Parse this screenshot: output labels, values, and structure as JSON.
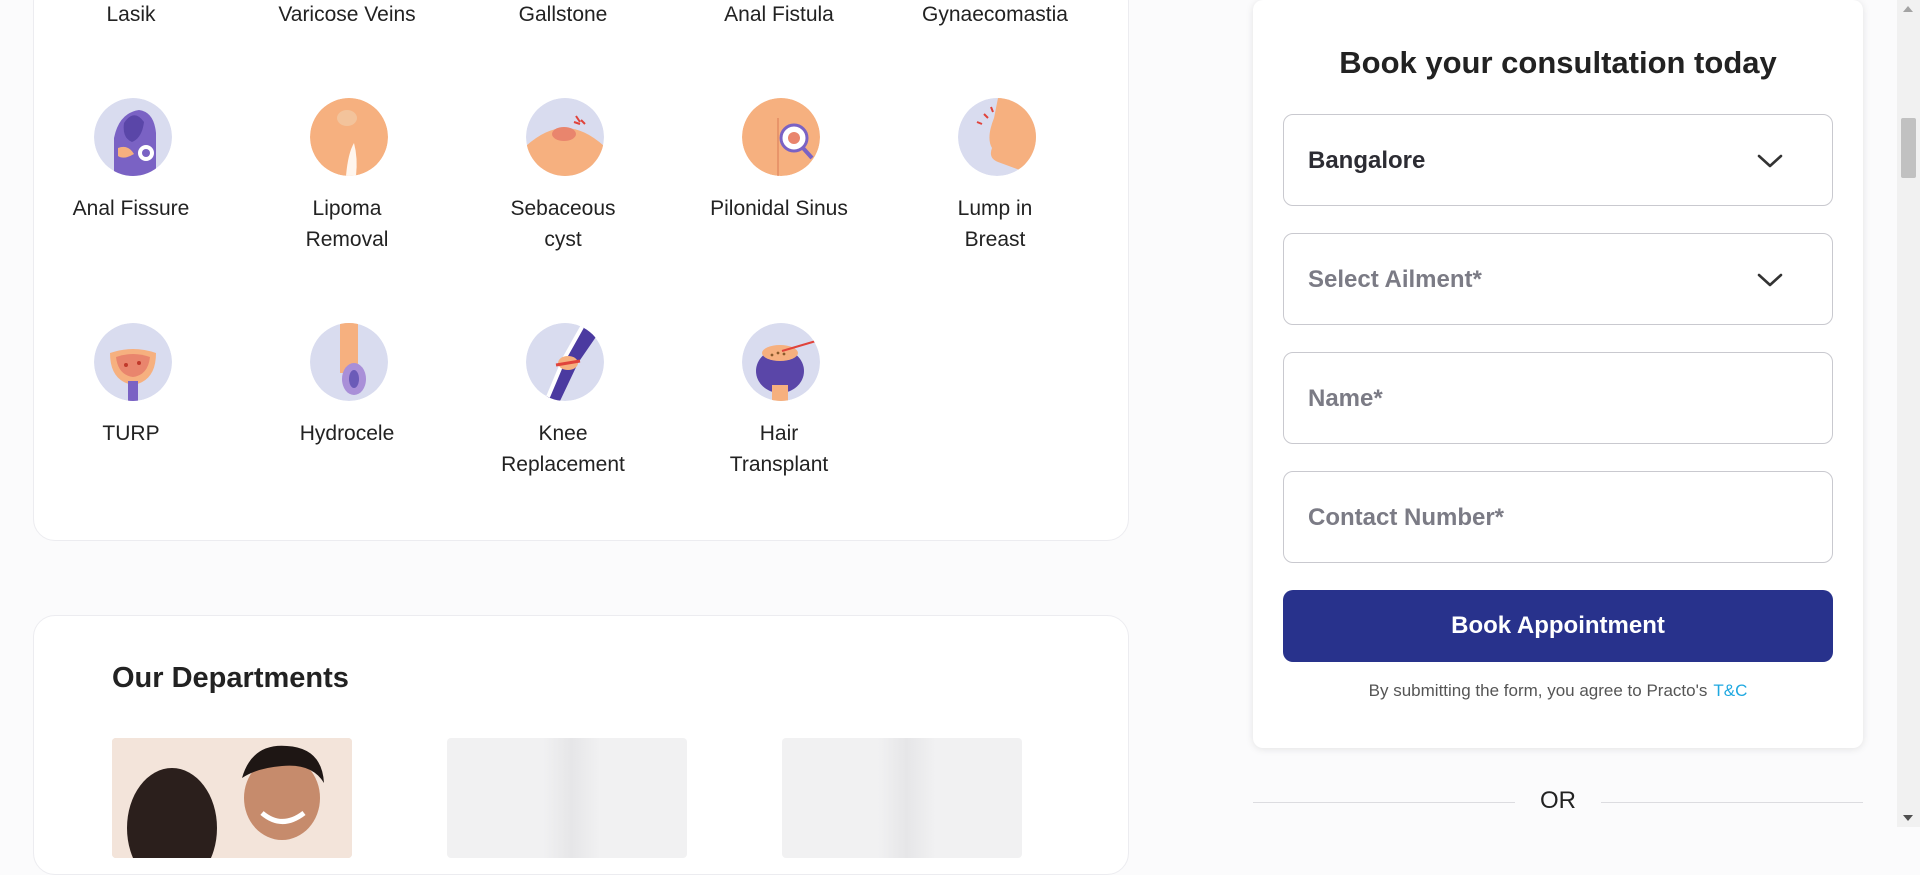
{
  "ailments": {
    "row1": [
      "Lasik",
      "Varicose Veins",
      "Gallstone",
      "Anal Fistula",
      "Gynaecomastia"
    ],
    "row2": [
      {
        "label": [
          "Anal Fissure"
        ],
        "icon": "anal-fissure-icon"
      },
      {
        "label": [
          "Lipoma",
          "Removal"
        ],
        "icon": "lipoma-removal-icon"
      },
      {
        "label": [
          "Sebaceous",
          "cyst"
        ],
        "icon": "sebaceous-cyst-icon"
      },
      {
        "label": [
          "Pilonidal Sinus"
        ],
        "icon": "pilonidal-sinus-icon"
      },
      {
        "label": [
          "Lump in",
          "Breast"
        ],
        "icon": "lump-in-breast-icon"
      }
    ],
    "row3": [
      {
        "label": [
          "TURP"
        ],
        "icon": "turp-icon"
      },
      {
        "label": [
          "Hydrocele"
        ],
        "icon": "hydrocele-icon"
      },
      {
        "label": [
          "Knee",
          "Replacement"
        ],
        "icon": "knee-replacement-icon"
      },
      {
        "label": [
          "Hair",
          "Transplant"
        ],
        "icon": "hair-transplant-icon"
      }
    ]
  },
  "departments": {
    "title": "Our Departments"
  },
  "form": {
    "title": "Book your consultation today",
    "city_value": "Bangalore",
    "ailment_placeholder": "Select Ailment*",
    "name_placeholder": "Name*",
    "contact_placeholder": "Contact Number*",
    "submit_label": "Book Appointment",
    "terms_text": "By submitting the form, you agree to Practo's",
    "terms_link": "T&C",
    "or_text": "OR"
  },
  "colors": {
    "primary_button": "#28328c",
    "link": "#1fa8e0",
    "icon_purple": "#6b5bb8",
    "icon_peach": "#f6b07f"
  }
}
